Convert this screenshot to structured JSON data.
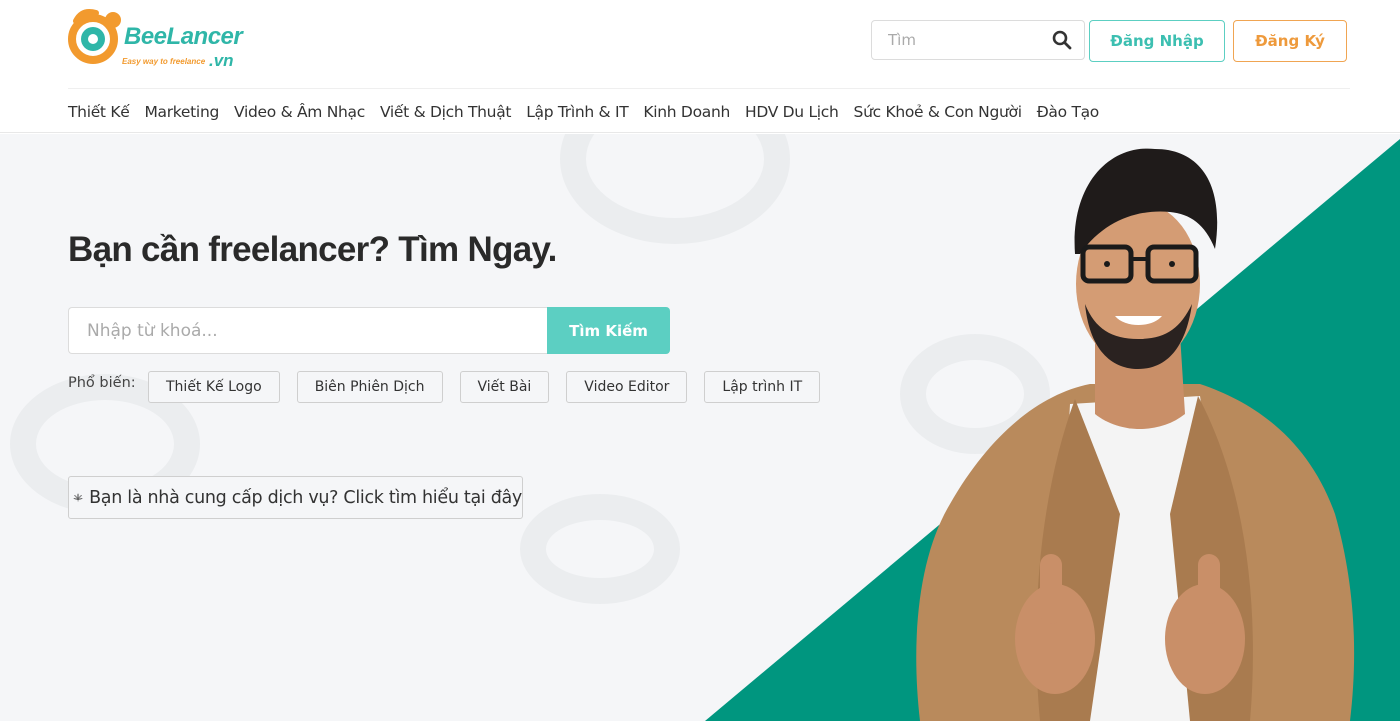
{
  "brand": {
    "name": "BeeLancer",
    "suffix": ".vn",
    "tagline": "Easy way to freelance",
    "colors": {
      "teal": "#5ccfc2",
      "orange": "#ee9a3c",
      "hero_teal": "#00967f"
    }
  },
  "header": {
    "search_placeholder": "Tìm",
    "login_label": "Đăng Nhập",
    "register_label": "Đăng Ký"
  },
  "nav": {
    "items": [
      {
        "label": "Thiết Kế"
      },
      {
        "label": "Marketing"
      },
      {
        "label": "Video & Âm Nhạc"
      },
      {
        "label": "Viết & Dịch Thuật"
      },
      {
        "label": "Lập Trình & IT"
      },
      {
        "label": "Kinh Doanh"
      },
      {
        "label": "HDV Du Lịch"
      },
      {
        "label": "Sức Khoẻ & Con Người"
      },
      {
        "label": "Đào Tạo"
      }
    ]
  },
  "hero": {
    "title": "Bạn cần freelancer? Tìm Ngay.",
    "search_placeholder": "Nhập từ khoá...",
    "search_button": "Tìm Kiếm",
    "popular_label": "Phổ biến:",
    "popular_tags": [
      "Thiết Kế Logo",
      "Biên Phiên Dịch",
      "Viết Bài",
      "Video Editor",
      "Lập trình IT"
    ],
    "provider_link": "Bạn là nhà cung cấp dịch vụ? Click tìm hiểu tại đây"
  }
}
